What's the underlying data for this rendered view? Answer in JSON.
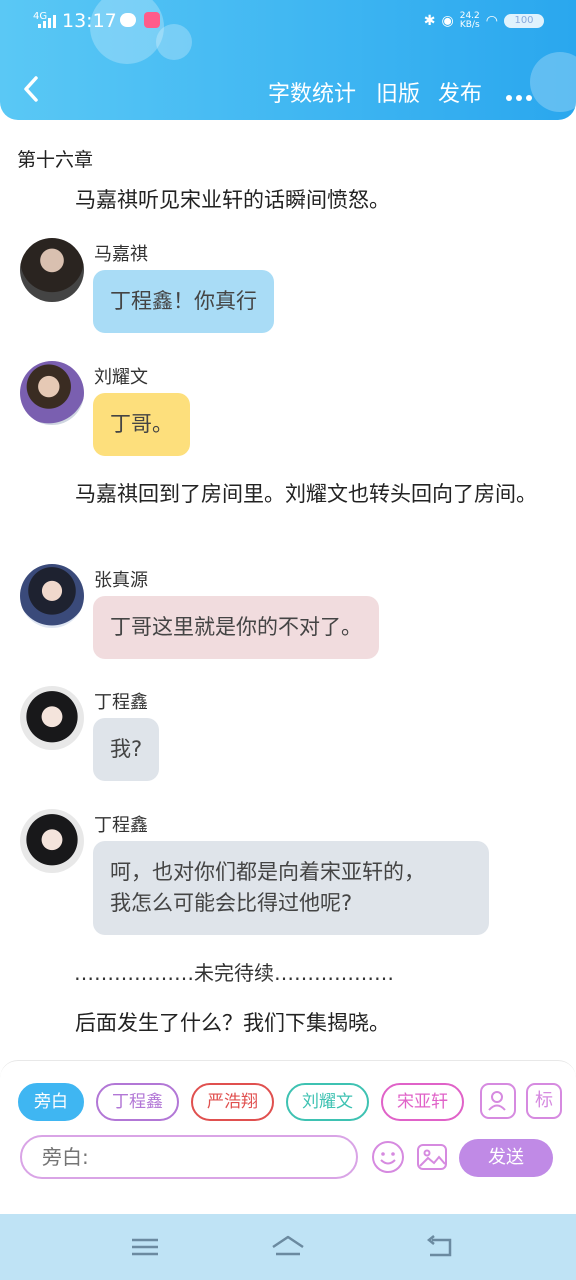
{
  "status_bar": {
    "network": "4G",
    "time": "13:17",
    "speed_top": "24.2",
    "speed_bottom": "KB/s",
    "battery": "100"
  },
  "header": {
    "word_count_label": "字数统计",
    "old_version_label": "旧版",
    "publish_label": "发布"
  },
  "story": {
    "chapter": "第十六章",
    "narration_1": "马嘉祺听见宋业轩的话瞬间愤怒。",
    "messages": [
      {
        "name": "马嘉祺",
        "text": "丁程鑫！你真行",
        "bubble_color": "#a9dcf6"
      },
      {
        "name": "刘耀文",
        "text": "丁哥。",
        "bubble_color": "#fddf7c"
      },
      {
        "name": "张真源",
        "text": "丁哥这里就是你的不对了。",
        "bubble_color": "#f1dcde"
      },
      {
        "name": "丁程鑫",
        "text": "我?",
        "bubble_color": "#dfe4ea"
      },
      {
        "name": "丁程鑫",
        "text_line1": "呵，也对你们都是向着宋亚轩的，",
        "text_line2": "我怎么可能会比得过他呢?",
        "bubble_color": "#dfe4ea"
      }
    ],
    "narration_2": "马嘉祺回到了房间里。刘耀文也转头回向了房间。",
    "divider": "………………未完待续………………",
    "narration_3": "后面发生了什么？我们下集揭晓。"
  },
  "composer": {
    "chips": [
      {
        "label": "旁白",
        "color": "#3fb6f2"
      },
      {
        "label": "丁程鑫",
        "color": "#b277d6"
      },
      {
        "label": "严浩翔",
        "color": "#e0504f"
      },
      {
        "label": "刘耀文",
        "color": "#3ec2b2"
      },
      {
        "label": "宋亚轩",
        "color": "#e062c8"
      }
    ],
    "tag_label": "标",
    "input_placeholder": "旁白:",
    "send_label": "发送"
  }
}
